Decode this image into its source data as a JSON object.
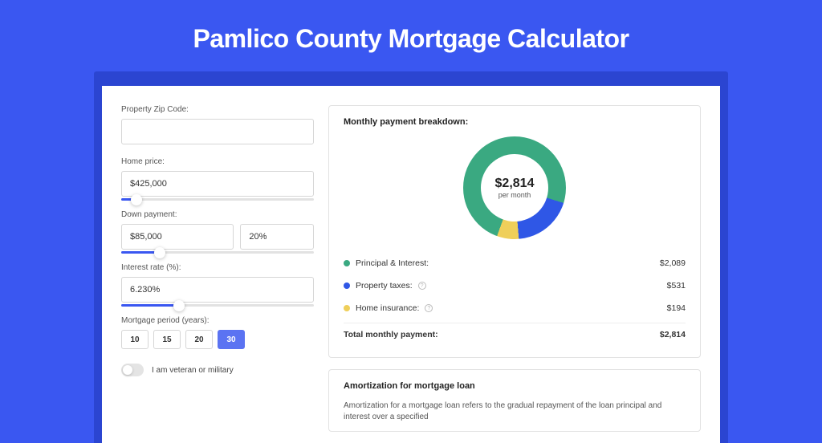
{
  "title": "Pamlico County Mortgage Calculator",
  "colors": {
    "principal": "#3aa981",
    "taxes": "#2f57e6",
    "insurance": "#efcf5a"
  },
  "form": {
    "zip": {
      "label": "Property Zip Code:",
      "value": ""
    },
    "homePrice": {
      "label": "Home price:",
      "value": "$425,000",
      "sliderPct": 8
    },
    "downPayment": {
      "label": "Down payment:",
      "amount": "$85,000",
      "pct": "20%",
      "sliderPct": 20
    },
    "interest": {
      "label": "Interest rate (%):",
      "value": "6.230%",
      "sliderPct": 30
    },
    "period": {
      "label": "Mortgage period (years):",
      "options": [
        "10",
        "15",
        "20",
        "30"
      ],
      "selected": "30"
    },
    "veteran": {
      "label": "I am veteran or military",
      "checked": false
    }
  },
  "breakdown": {
    "title": "Monthly payment breakdown:",
    "centerAmount": "$2,814",
    "centerSub": "per month",
    "items": [
      {
        "key": "principal",
        "label": "Principal & Interest:",
        "value": "$2,089",
        "info": false
      },
      {
        "key": "taxes",
        "label": "Property taxes:",
        "value": "$531",
        "info": true
      },
      {
        "key": "insurance",
        "label": "Home insurance:",
        "value": "$194",
        "info": true
      }
    ],
    "totalLabel": "Total monthly payment:",
    "totalValue": "$2,814"
  },
  "chart_data": {
    "type": "pie",
    "title": "Monthly payment breakdown",
    "categories": [
      "Principal & Interest",
      "Property taxes",
      "Home insurance"
    ],
    "values": [
      2089,
      531,
      194
    ],
    "total": 2814,
    "unit": "USD per month"
  },
  "amortization": {
    "title": "Amortization for mortgage loan",
    "body": "Amortization for a mortgage loan refers to the gradual repayment of the loan principal and interest over a specified"
  }
}
